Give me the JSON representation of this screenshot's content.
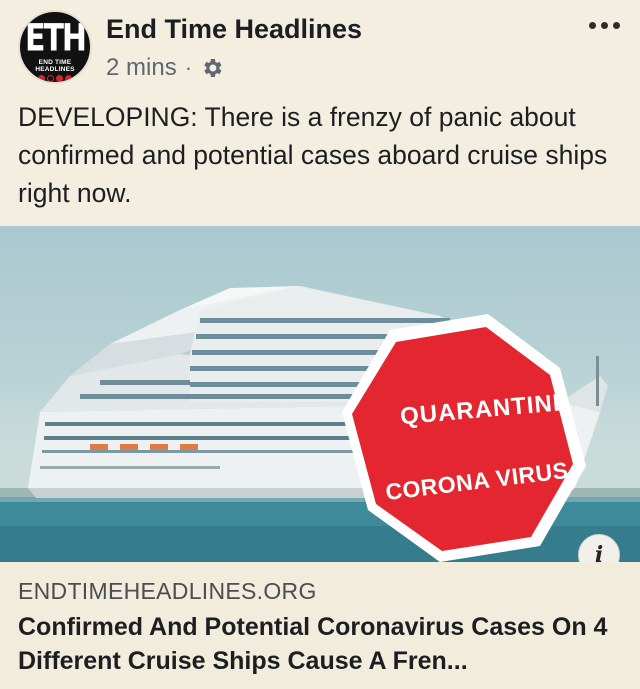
{
  "page": {
    "name": "End Time Headlines",
    "avatar_monogram": "ETH",
    "avatar_subtitle": "END TIME HEADLINES",
    "time": "2 mins",
    "separator": "·",
    "privacy_icon": "gear-icon",
    "menu_icon": "more-dots-icon"
  },
  "post": {
    "text": "DEVELOPING: There is a frenzy of panic about confirmed and potential cases aboard cruise ships right now."
  },
  "image": {
    "sign_line1": "QUARANTINE",
    "sign_line2": "CORONA VIRUS",
    "info_label": "i",
    "colors": {
      "sign_red": "#e3262f",
      "sky": "#a9c8cf",
      "sea": "#3f8a9a"
    }
  },
  "link": {
    "domain": "ENDTIMEHEADLINES.ORG",
    "headline": "Confirmed And Potential Coronavirus Cases On 4 Different Cruise Ships Cause A Fren..."
  }
}
